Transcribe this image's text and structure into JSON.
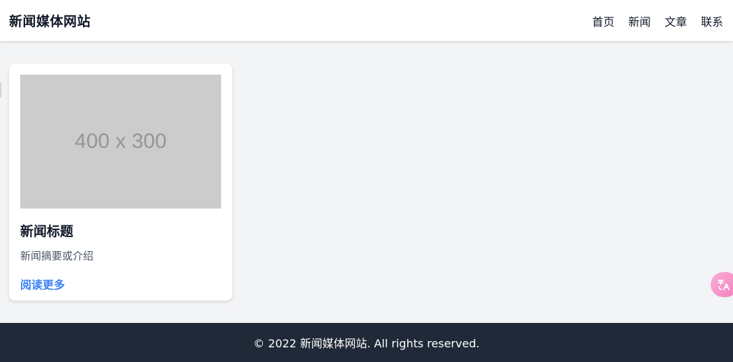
{
  "header": {
    "brand": "新闻媒体网站",
    "nav": [
      {
        "label": "首页"
      },
      {
        "label": "新闻"
      },
      {
        "label": "文章"
      },
      {
        "label": "联系"
      }
    ]
  },
  "card": {
    "image_placeholder": "400 x 300",
    "title": "新闻标题",
    "summary": "新闻摘要或介绍",
    "link_label": "阅读更多"
  },
  "footer": {
    "copyright": "© 2022 新闻媒体网站. All rights reserved."
  },
  "floating": {
    "translate_icon": "translate-icon"
  },
  "colors": {
    "background": "#f3f4f6",
    "header_bg": "#ffffff",
    "footer_bg": "#1f2937",
    "link": "#3b82f6",
    "placeholder_bg": "#cccccc",
    "placeholder_text": "#969696",
    "translate_button": "#f472b6"
  }
}
